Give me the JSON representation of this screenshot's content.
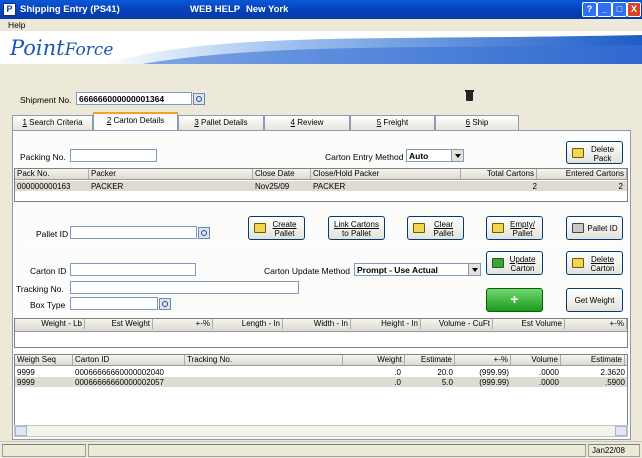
{
  "window": {
    "title": "Shipping Entry (PS41)",
    "web_help": "WEB HELP",
    "location": "New York",
    "app_icon_letter": "P",
    "help_btn": "?",
    "minimize_btn": "_",
    "maximize_btn": "□",
    "close_btn": "X"
  },
  "menu": {
    "help": "Help"
  },
  "brand": {
    "logo_a": "Point",
    "logo_b": "Force"
  },
  "shipment": {
    "label": "Shipment No.",
    "value": "666666000000001364"
  },
  "tabs": [
    {
      "key": "1",
      "label": " Search Criteria"
    },
    {
      "key": "2",
      "label": " Carton Details"
    },
    {
      "key": "3",
      "label": " Pallet Details"
    },
    {
      "key": "4",
      "label": " Review"
    },
    {
      "key": "5",
      "label": " Freight"
    },
    {
      "key": "6",
      "label": " Ship"
    }
  ],
  "packing": {
    "label": "Packing No.",
    "value": "",
    "entry_method_label": "Carton Entry Method",
    "entry_method_value": "Auto",
    "delete_pack_line1": "Delete",
    "delete_pack_line2": "Pack"
  },
  "pack_grid": {
    "headers": [
      "Pack No.",
      "Packer",
      "Close Date",
      "Close/Hold Packer",
      "Total Cartons",
      "Entered Cartons"
    ],
    "rows": [
      {
        "pack_no": "000000000163",
        "packer": "PACKER",
        "close_date": "Nov25/09",
        "close_hold": "PACKER",
        "total": "2",
        "entered": "2"
      }
    ]
  },
  "pallet": {
    "label": "Pallet ID",
    "value": "",
    "create_l1": "Create",
    "create_l2": "Pallet",
    "link_l1": "Link Cartons",
    "link_l2": "to Pallet",
    "clear_l1": "Clear",
    "clear_l2": "Pallet",
    "empty_l1": "Empty/",
    "empty_l2": "Pallet",
    "print_label": "Pallet ID"
  },
  "carton": {
    "id_label": "Carton ID",
    "id_value": "",
    "update_method_label": "Carton Update Method",
    "update_method_value": "Prompt - Use Actual",
    "update_l1": "Update",
    "update_l2": "Carton",
    "delete_l1": "Delete",
    "delete_l2": "Carton",
    "tracking_label": "Tracking No.",
    "tracking_value": "",
    "box_type_label": "Box Type",
    "box_type_value": "",
    "add_symbol": "+",
    "get_weight": "Get Weight"
  },
  "weight_grid": {
    "headers": [
      "Weight - Lb",
      "Est Weight",
      "+-%",
      "Length - In",
      "Width - In",
      "Height - In",
      "Volume - CuFt",
      "Est Volume",
      "+-%"
    ]
  },
  "seq_grid": {
    "headers": [
      "Weigh Seq",
      "Carton ID",
      "Tracking No.",
      "Weight",
      "Estimate",
      "+-%",
      "Volume",
      "Estimate"
    ],
    "rows": [
      {
        "seq": "9999",
        "carton": "00066666660000002040",
        "tracking": "",
        "weight": ".0",
        "estimate": "20.0",
        "pct": "(999.99)",
        "volume": ".0000",
        "vol_est": "2.3620"
      },
      {
        "seq": "9999",
        "carton": "00066666660000002057",
        "tracking": "",
        "weight": ".0",
        "estimate": "5.0",
        "pct": "(999.99)",
        "volume": ".0000",
        "vol_est": ".5900"
      }
    ]
  },
  "status": {
    "date": "Jan22/08"
  }
}
